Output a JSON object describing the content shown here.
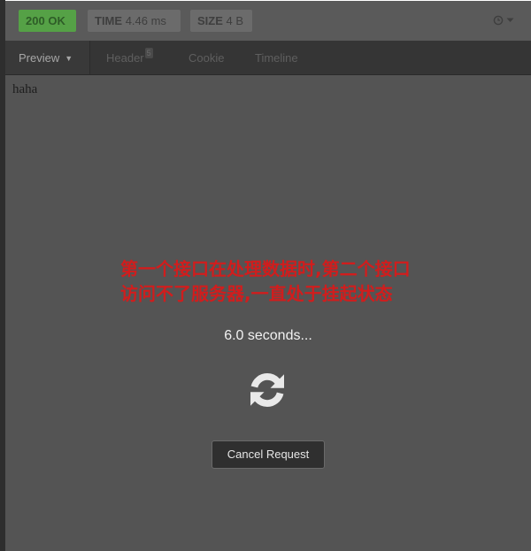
{
  "status": {
    "code": "200",
    "text": "OK",
    "time_label": "TIME",
    "time_value": "4.46 ms",
    "size_label": "SIZE",
    "size_value": "4 B",
    "ok_color": "#55a146"
  },
  "settings": {
    "icon": "clock-icon",
    "dropdown_icon": "caret-down-icon"
  },
  "tabs": [
    {
      "label": "Preview",
      "active": true
    },
    {
      "label": "Header",
      "badge": "5"
    },
    {
      "label": "Cookie"
    },
    {
      "label": "Timeline"
    }
  ],
  "response": {
    "body": "haha"
  },
  "annotation": {
    "line1": "第一个接口在处理数据时,第二个接口",
    "line2": "访问不了服务器,一直处于挂起状态",
    "color": "#d11d1d"
  },
  "loading": {
    "text": "6.0 seconds...",
    "icon": "refresh-icon",
    "cancel_label": "Cancel Request"
  }
}
